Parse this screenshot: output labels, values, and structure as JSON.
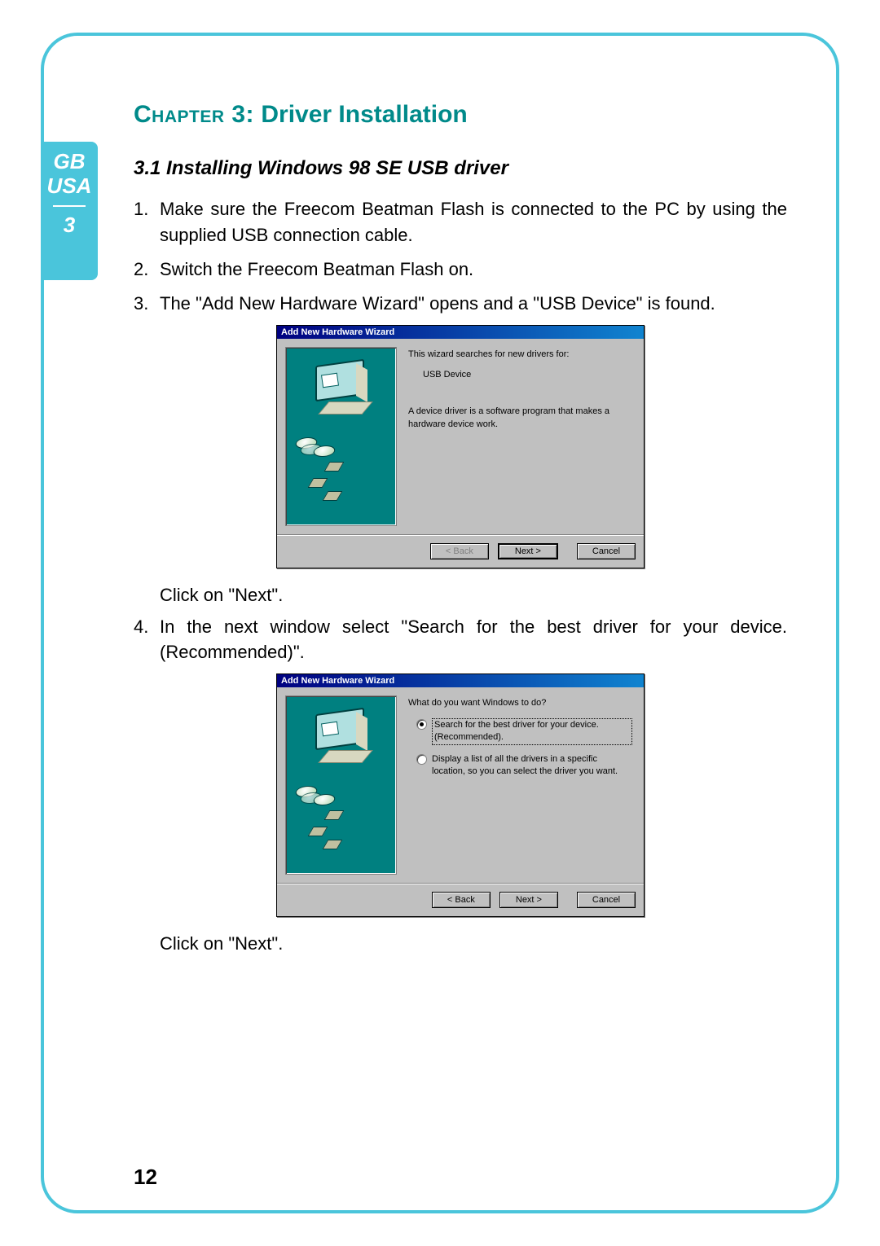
{
  "side": {
    "lang1": "GB",
    "lang2": "USA",
    "chapter": "3"
  },
  "chapter_title_prefix": "Chapter 3:",
  "chapter_title_rest": " Driver Installation",
  "section_title": "3.1  Installing Windows 98 SE USB driver",
  "steps": {
    "s1": "Make sure the Freecom Beatman Flash is connected to the PC by using the supplied USB connection cable.",
    "s2": "Switch the Freecom Beatman Flash on.",
    "s3": "The \"Add New Hardware Wizard\" opens and a \"USB  Device\" is found.",
    "s3b": "Click on \"Next\".",
    "s4": "In the next window select \"Search for the best driver for your device. (Recommended)\".",
    "s4b": "Click on \"Next\"."
  },
  "dialog1": {
    "title": "Add New Hardware Wizard",
    "line1": "This wizard searches for new drivers for:",
    "device": "USB Device",
    "line2": "A device driver is a software program that makes a hardware device work.",
    "back": "< Back",
    "next": "Next >",
    "cancel": "Cancel"
  },
  "dialog2": {
    "title": "Add New Hardware Wizard",
    "prompt": "What do you want Windows to do?",
    "opt1a": "Search for the best driver for your device.",
    "opt1b": "(Recommended).",
    "opt2": "Display a list of all the drivers in a specific location, so you can select the driver you want.",
    "back": "< Back",
    "next": "Next >",
    "cancel": "Cancel"
  },
  "page_number": "12"
}
